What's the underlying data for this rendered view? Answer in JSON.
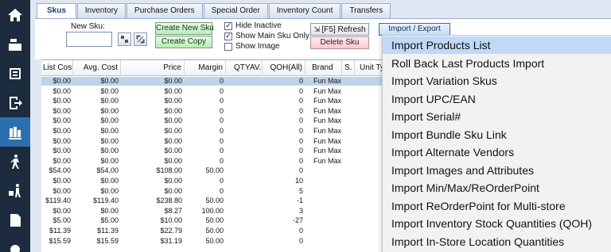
{
  "tabs": [
    {
      "label": "Skus",
      "active": true
    },
    {
      "label": "Inventory"
    },
    {
      "label": "Purchase Orders"
    },
    {
      "label": "Special Order"
    },
    {
      "label": "Inventory Count"
    },
    {
      "label": "Transfers"
    }
  ],
  "toolbar": {
    "new_sku_label": "New Sku:",
    "new_sku_value": "",
    "create_new_sku": "Create New Sku",
    "create_copy": "Create Copy",
    "hide_inactive": "Hide Inactive",
    "show_main_sku_only": "Show Main Sku Only",
    "show_image": "Show Image",
    "hide_inactive_checked": "✓",
    "show_main_sku_only_checked": "✓",
    "refresh": "[F5] Refresh",
    "delete_sku": "Delete Sku",
    "import_export": "Import / Export"
  },
  "grid": {
    "columns": [
      "List Cost",
      "Avg. Cost",
      "Price",
      "Margin",
      "QTYAV...",
      "QOH(All)",
      "Brand",
      "S.",
      "Unit Typ"
    ],
    "rows": [
      [
        "$0.00",
        "$0.00",
        "$0.00",
        "0",
        "",
        "0",
        "Fun Max"
      ],
      [
        "$0.00",
        "$0.00",
        "$0.00",
        "0",
        "",
        "0",
        "Fun Max"
      ],
      [
        "$0.00",
        "$0.00",
        "$0.00",
        "0",
        "",
        "0",
        "Fun Max"
      ],
      [
        "$0.00",
        "$0.00",
        "$0.00",
        "0",
        "",
        "0",
        "Fun Max"
      ],
      [
        "$0.00",
        "$0.00",
        "$0.00",
        "0",
        "",
        "0",
        "Fun Max"
      ],
      [
        "$0.00",
        "$0.00",
        "$0.00",
        "0",
        "",
        "0",
        "Fun Max"
      ],
      [
        "$0.00",
        "$0.00",
        "$0.00",
        "0",
        "",
        "0",
        "Fun Max"
      ],
      [
        "$0.00",
        "$0.00",
        "$0.00",
        "0",
        "",
        "0",
        "Fun Max"
      ],
      [
        "$0.00",
        "$0.00",
        "$0.00",
        "0",
        "",
        "0",
        "Fun Max"
      ],
      [
        "$54.00",
        "$54.00",
        "$108.00",
        "50.00",
        "",
        "0",
        ""
      ],
      [
        "$0.00",
        "$0.00",
        "$0.00",
        "0",
        "",
        "10",
        ""
      ],
      [
        "$0.00",
        "$0.00",
        "$0.00",
        "0",
        "",
        "5",
        ""
      ],
      [
        "$119.40",
        "$119.40",
        "$238.80",
        "50.00",
        "",
        "-1",
        ""
      ],
      [
        "$0.00",
        "$0.00",
        "$8.27",
        "100.00",
        "",
        "3",
        ""
      ],
      [
        "$5.00",
        "$5.00",
        "$10.00",
        "50.00",
        "",
        "-27",
        ""
      ],
      [
        "$11.39",
        "$11.39",
        "$22.79",
        "50.00",
        "",
        "0",
        ""
      ],
      [
        "$15.59",
        "$15.59",
        "$31.19",
        "50.00",
        "",
        "0",
        ""
      ]
    ]
  },
  "menu": {
    "items": [
      "Import Products List",
      "Roll Back Last Products Import",
      "Import Variation Skus",
      "Import UPC/EAN",
      "Import Serial#",
      "Import Bundle Sku Link",
      "Import Alternate Vendors",
      "Import Images and Attributes",
      "Import Min/Max/ReOrderPoint",
      "Import ReOrderPoint for Multi-store",
      "Import Inventory Stock Quantities (QOH)",
      "Import In-Store Location Quantities"
    ]
  },
  "rail": {
    "icons": [
      "home-icon",
      "register-icon",
      "pos-icon",
      "exit-icon",
      "inventory-icon",
      "walker-icon",
      "delivery-icon",
      "document-icon",
      "settings-icon"
    ]
  },
  "colors": {
    "rail_bg": "#1c2b3e",
    "rail_active": "#2a6fb0",
    "selected_row": "#bed3ec",
    "menu_highlight": "#bfd9f6"
  }
}
